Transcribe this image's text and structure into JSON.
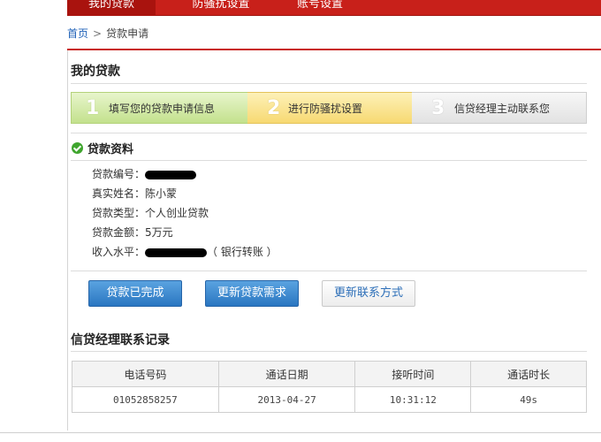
{
  "nav": {
    "tabs": [
      {
        "label": "我的贷款"
      },
      {
        "label": "防骚扰设置"
      },
      {
        "label": "账号设置"
      }
    ]
  },
  "breadcrumb": {
    "home": "首页",
    "sep": ">",
    "current": "贷款申请"
  },
  "page_title": "我的贷款",
  "steps": [
    {
      "num": "1",
      "label": "填写您的贷款申请信息",
      "state": "done"
    },
    {
      "num": "2",
      "label": "进行防骚扰设置",
      "state": "current"
    },
    {
      "num": "3",
      "label": "信贷经理主动联系您",
      "state": "pending"
    }
  ],
  "loan_info": {
    "title": "贷款资料",
    "rows": {
      "loan_id": {
        "label": "贷款编号：",
        "value": ""
      },
      "real_name": {
        "label": "真实姓名：",
        "value": "陈小蒙"
      },
      "loan_type": {
        "label": "贷款类型：",
        "value": "个人创业贷款"
      },
      "amount": {
        "label": "贷款金额：",
        "value": "5万元"
      },
      "income": {
        "label": "收入水平：",
        "value": "",
        "suffix": "（ 银行转账 ）"
      }
    }
  },
  "buttons": {
    "completed": "贷款已完成",
    "update_need": "更新贷款需求",
    "update_contact": "更新联系方式"
  },
  "records": {
    "title": "信贷经理联系记录",
    "columns": [
      "电话号码",
      "通话日期",
      "接听时间",
      "通话时长"
    ],
    "rows": [
      [
        "01052858257",
        "2013-04-27",
        "10:31:12",
        "49s"
      ]
    ]
  },
  "colors": {
    "brand_red": "#c8201a",
    "link_blue": "#1f62b8",
    "button_blue": "#2a76c1",
    "success_green": "#3fa52e"
  }
}
